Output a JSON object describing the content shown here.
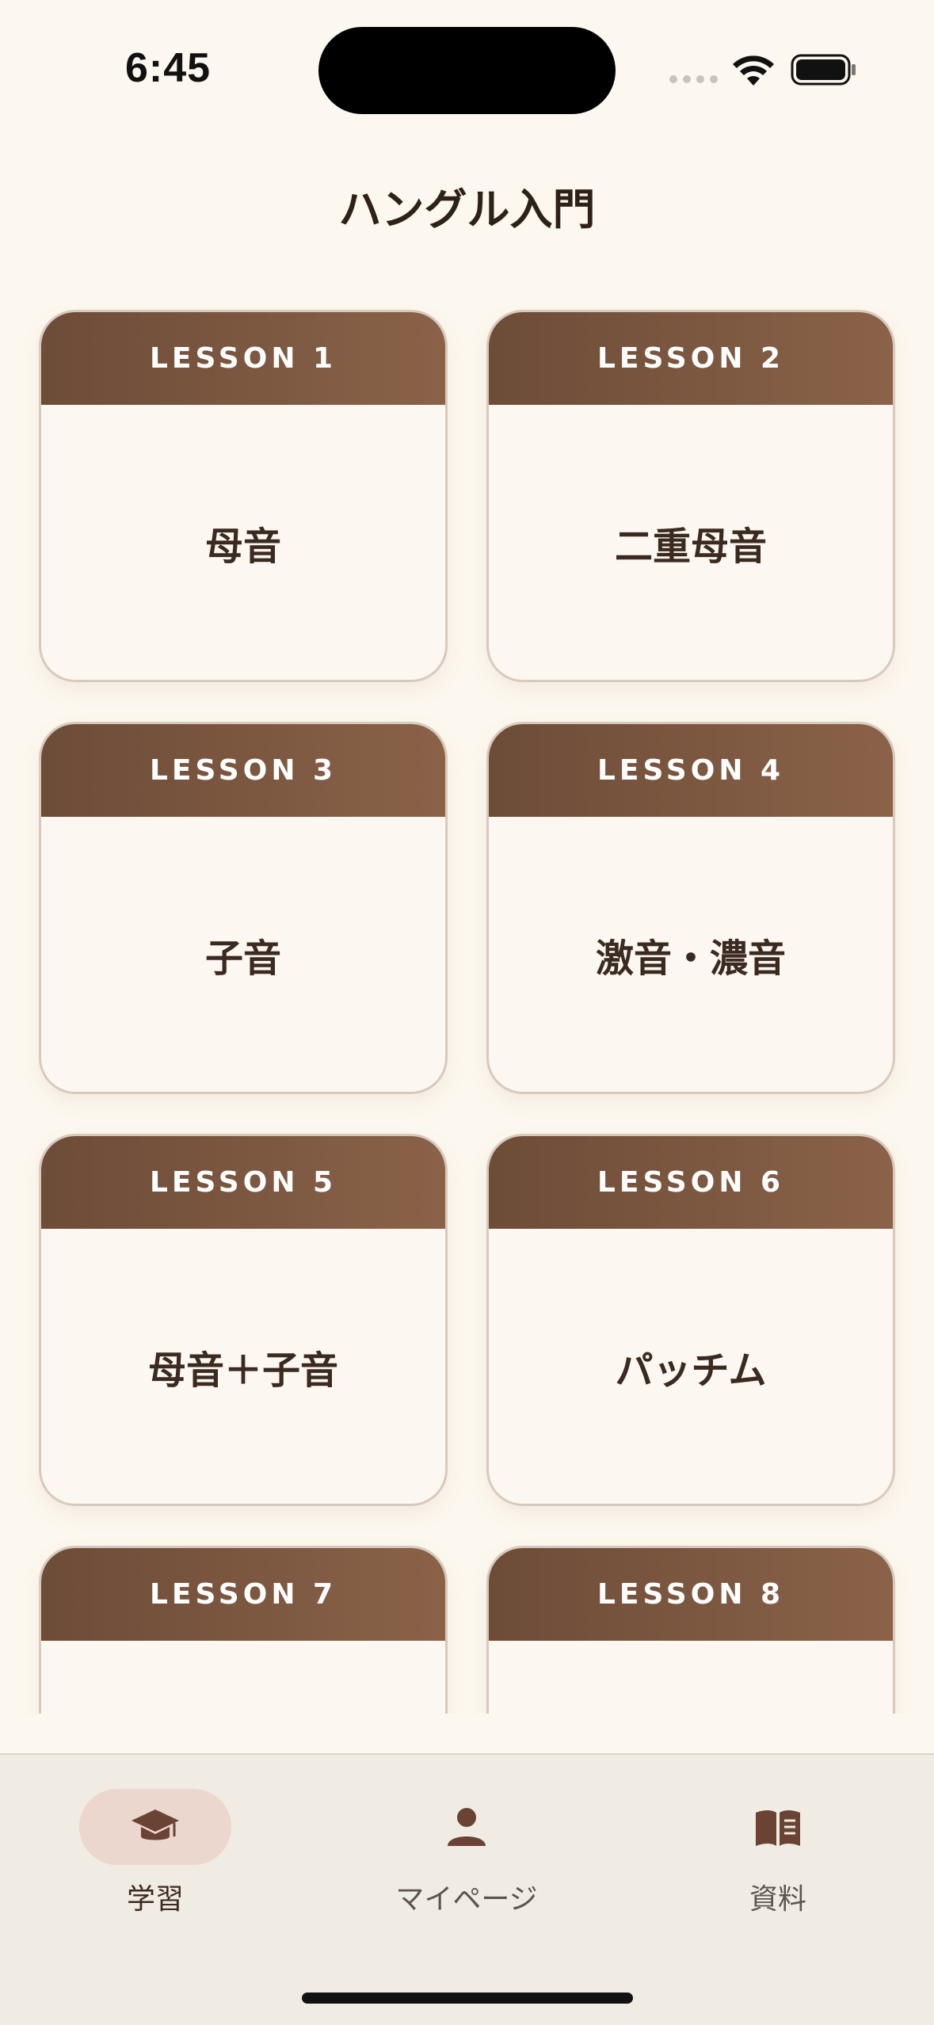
{
  "status_bar": {
    "time": "6:45",
    "icons": [
      "cellular-signal-icon",
      "wifi-icon",
      "battery-icon"
    ]
  },
  "page": {
    "title": "ハングル入門"
  },
  "lessons": [
    {
      "header": "LESSON 1",
      "title": "母音"
    },
    {
      "header": "LESSON 2",
      "title": "二重母音"
    },
    {
      "header": "LESSON 3",
      "title": "子音"
    },
    {
      "header": "LESSON 4",
      "title": "激音・濃音"
    },
    {
      "header": "LESSON 5",
      "title": "母音＋子音"
    },
    {
      "header": "LESSON 6",
      "title": "パッチム"
    },
    {
      "header": "LESSON 7",
      "title": ""
    },
    {
      "header": "LESSON 8",
      "title": ""
    }
  ],
  "tab_bar": {
    "tabs": [
      {
        "label": "学習",
        "icon": "graduation-cap-icon",
        "selected": true
      },
      {
        "label": "マイページ",
        "icon": "person-icon",
        "selected": false
      },
      {
        "label": "資料",
        "icon": "book-icon",
        "selected": false
      }
    ]
  },
  "colors": {
    "background": "#fdf8ef",
    "card_header": "#7a563f",
    "card_body": "#fdf7f1",
    "accent_pill": "#ebd7cd",
    "icon_brown": "#6a4334"
  }
}
